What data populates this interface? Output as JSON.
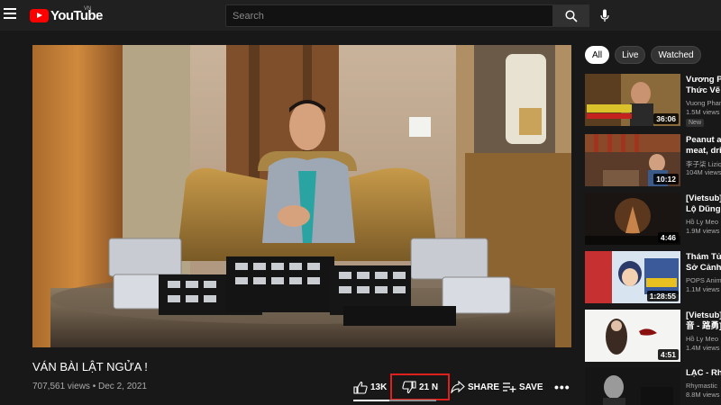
{
  "header": {
    "logo_text": "YouTube",
    "country_code": "VN",
    "search_placeholder": "Search",
    "search_value": ""
  },
  "video": {
    "title": "VÁN BÀI LẬT NGỬA !",
    "views": "707,561 views",
    "date": "Dec 2, 2021",
    "meta_separator": "•",
    "like_count": "13K",
    "dislike_count": "21 N",
    "share_label": "SHARE",
    "save_label": "SAVE",
    "more_label": "•••"
  },
  "chips": [
    "All",
    "Live",
    "Watched"
  ],
  "recommendations": [
    {
      "title": "Vương Ph",
      "title2": "Thức Vẽ C",
      "channel": "Vuong Pham",
      "views": "1.5M views",
      "duration": "36:06",
      "badge": "New"
    },
    {
      "title": "Peanut an",
      "title2": "meat, drie",
      "channel": "李子柒 Liziq",
      "views": "104M views",
      "duration": "10:12",
      "badge": ""
    },
    {
      "title": "[Vietsub]",
      "title2": "Lộ Dũng [",
      "channel": "Hồ Ly Meo",
      "views": "1.9M views",
      "duration": "4:46",
      "badge": ""
    },
    {
      "title": "Thám Tử",
      "title2": "Sở Cảnh S",
      "channel": "POPS Anim",
      "views": "1.1M views",
      "duration": "1:28:55",
      "badge": ""
    },
    {
      "title": "[Vietsub]",
      "title2": "音 - 路勇]",
      "channel": "Hồ Ly Meo",
      "views": "1.4M views",
      "duration": "4:51",
      "badge": ""
    },
    {
      "title": "LẠC - Rhy",
      "title2": "",
      "channel": "Rhymastic",
      "views": "8.8M views",
      "duration": "",
      "badge": ""
    }
  ],
  "colors": {
    "highlight": "#e0201c",
    "brand": "#ff0000"
  }
}
